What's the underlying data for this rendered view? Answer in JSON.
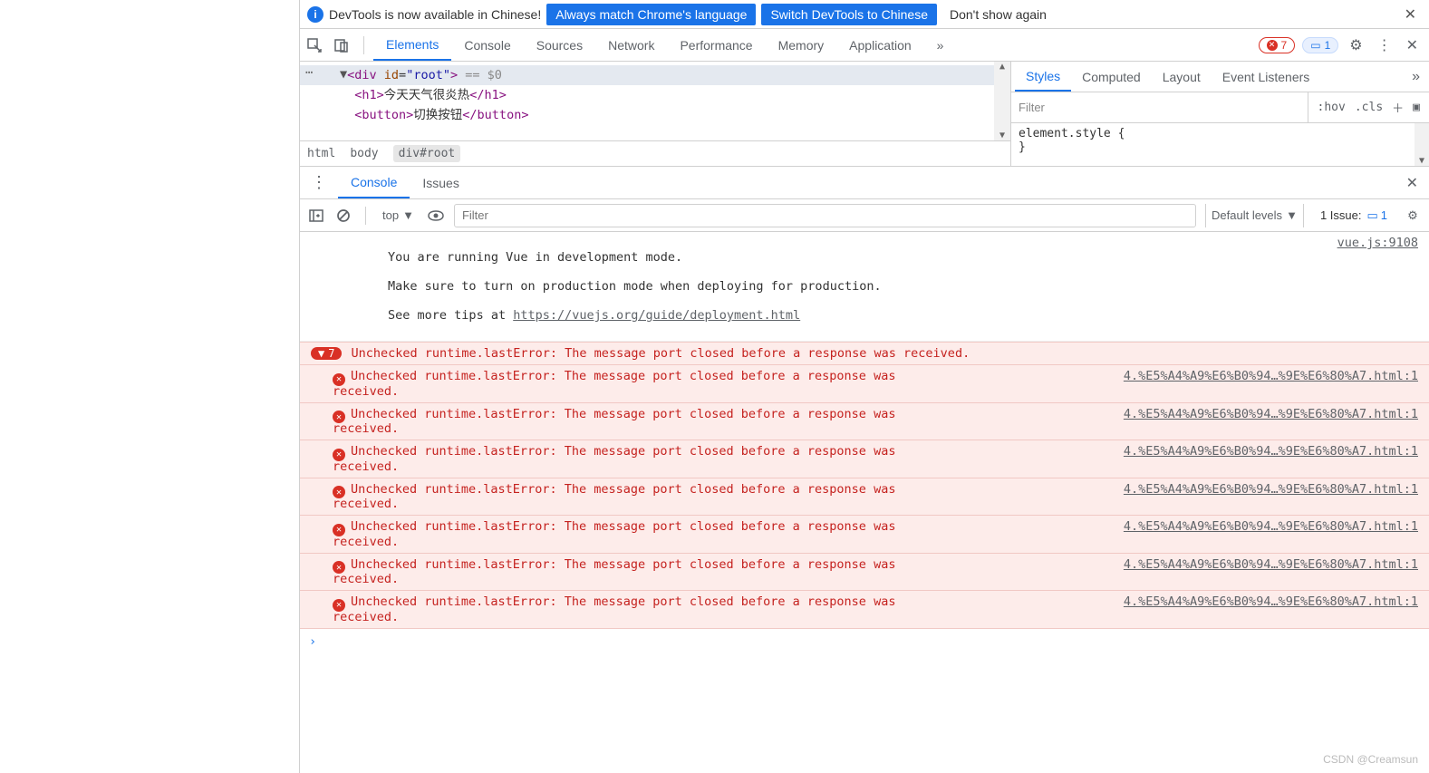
{
  "infobar": {
    "text": "DevTools is now available in Chinese!",
    "match_btn": "Always match Chrome's language",
    "switch_btn": "Switch DevTools to Chinese",
    "dismiss_btn": "Don't show again"
  },
  "toolbar": {
    "tabs": [
      "Elements",
      "Console",
      "Sources",
      "Network",
      "Performance",
      "Memory",
      "Application"
    ],
    "active_tab": "Elements",
    "error_count": "7",
    "issue_count": "1"
  },
  "elements": {
    "sel_open": "<div id=\"root\">",
    "sel_var": "== $0",
    "line_h1_open": "<h1>",
    "line_h1_text": "今天天气很炎热",
    "line_h1_close": "</h1>",
    "line_btn_open": "<button>",
    "line_btn_text": "切换按钮",
    "line_btn_close": "</button>",
    "crumbs": [
      "html",
      "body",
      "div#root"
    ]
  },
  "styles": {
    "tabs": [
      "Styles",
      "Computed",
      "Layout",
      "Event Listeners"
    ],
    "filter_ph": "Filter",
    "hov": ":hov",
    "cls": ".cls",
    "rule_head": "element.style {",
    "rule_tail": "}"
  },
  "drawer": {
    "tabs": [
      "Console",
      "Issues"
    ],
    "active": "Console"
  },
  "console": {
    "ctx": "top",
    "filter_ph": "Filter",
    "levels": "Default levels",
    "issue_label": "1 Issue:",
    "issue_num": "1",
    "vue_l1": "You are running Vue in development mode.",
    "vue_l2": "Make sure to turn on production mode when deploying for production.",
    "vue_l3_pre": "See more tips at ",
    "vue_l3_link": "https://vuejs.org/guide/deployment.html",
    "vue_src": "vue.js:9108",
    "group_count": "7",
    "group_msg": "Unchecked runtime.lastError: The message port closed before a response was received.",
    "err_msg": "Unchecked runtime.lastError: The message port closed before a response was received.",
    "err_src": "4.%E5%A4%A9%E6%B0%94…%9E%E6%80%A7.html:1",
    "errors": [
      0,
      1,
      2,
      3,
      4,
      5,
      6
    ]
  },
  "watermark": "CSDN @Creamsun"
}
